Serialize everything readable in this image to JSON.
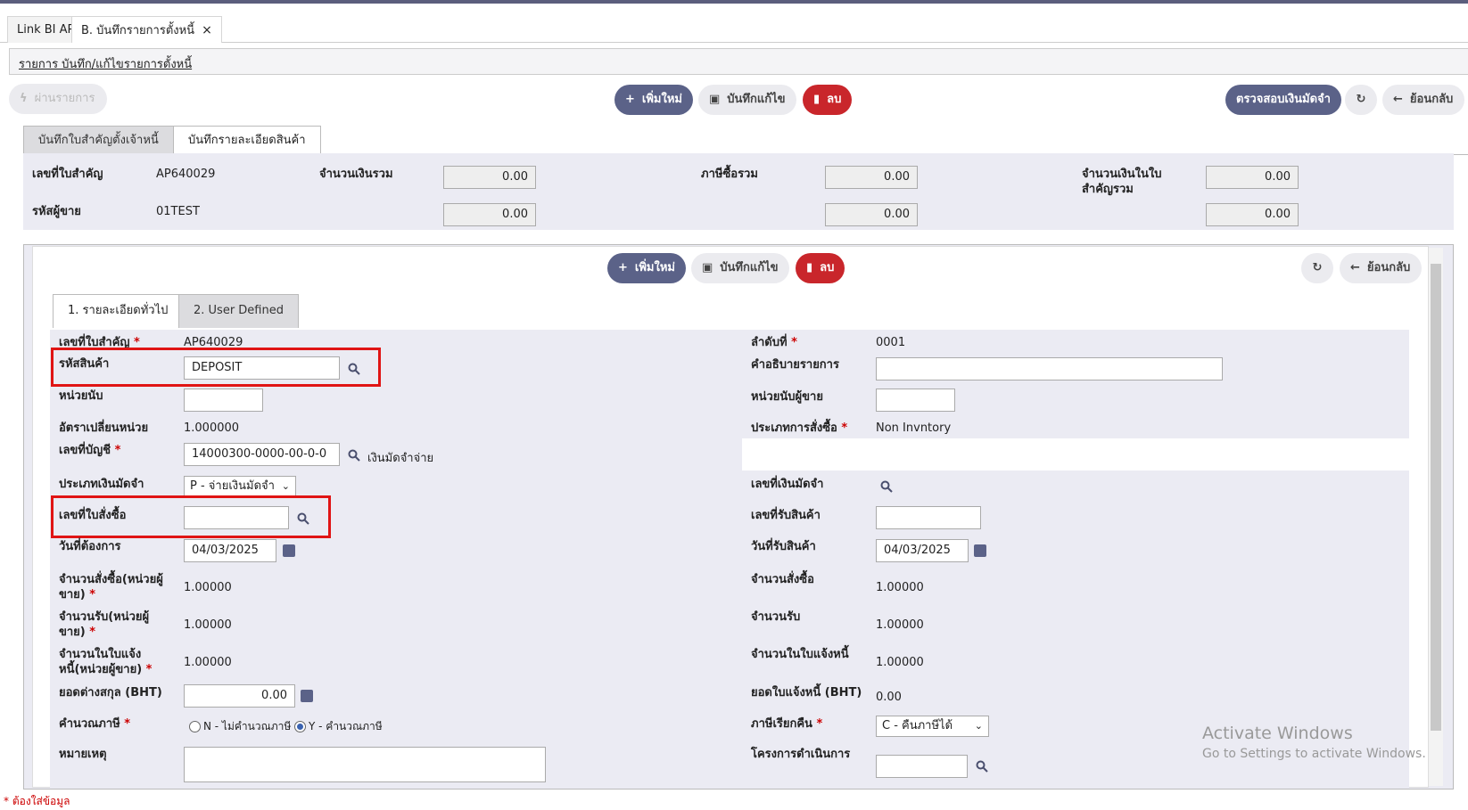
{
  "tabs": [
    {
      "label": "Link BI AP"
    },
    {
      "label": "B. บันทึกรายการตั้งหนี้",
      "close": "×"
    }
  ],
  "breadcrumb": "รายการ บันทึก/แก้ไขรายการตั้งหนี้",
  "toolbar": {
    "pass_label": "ผ่านรายการ",
    "add_label": "เพิ่มใหม่",
    "save_label": "บันทึกแก้ไข",
    "delete_label": "ลบ",
    "check_deposit_label": "ตรวจสอบเงินมัดจำ",
    "back_label": "ย้อนกลับ"
  },
  "subtabs": [
    "บันทึกใบสำคัญตั้งเจ้าหนี้",
    "บันทึกรายละเอียดสินค้า"
  ],
  "header": {
    "voucher_no_label": "เลขที่ใบสำคัญ",
    "voucher_no": "AP640029",
    "vendor_code_label": "รหัสผู้ขาย",
    "vendor_code": "01TEST",
    "total_amount_label": "จำนวนเงินรวม",
    "total_tax_label": "ภาษีซื้อรวม",
    "voucher_total_label": "จำนวนเงินในใบสำคัญรวม",
    "amounts": [
      "0.00",
      "0.00",
      "0.00",
      "0.00",
      "0.00",
      "0.00"
    ]
  },
  "inner_toolbar": {
    "add_label": "เพิ่มใหม่",
    "save_label": "บันทึกแก้ไข",
    "delete_label": "ลบ",
    "back_label": "ย้อนกลับ"
  },
  "inner_tabs": [
    "1. รายละเอียดทั่วไป",
    "2. User Defined"
  ],
  "form": {
    "voucher_no_label": "เลขที่ใบสำคัญ",
    "voucher_no": "AP640029",
    "seq_label": "ลำดับที่",
    "seq": "0001",
    "product_code_label": "รหัสสินค้า",
    "product_code": "DEPOSIT",
    "desc_label": "คำอธิบายรายการ",
    "unit_label": "หน่วยนับ",
    "vendor_unit_label": "หน่วยนับผู้ขาย",
    "conv_rate_label": "อัตราเปลี่ยนหน่วย",
    "conv_rate": "1.000000",
    "order_type_label": "ประเภทการสั่งซื้อ",
    "order_type": "Non Invntory",
    "account_label": "เลขที่บัญชี",
    "account": "14000300-0000-00-0-0",
    "account_name": "เงินมัดจำจ่าย",
    "deposit_type_label": "ประเภทเงินมัดจำ",
    "deposit_type": "P - จ่ายเงินมัดจำ",
    "deposit_no_label": "เลขที่เงินมัดจำ",
    "po_no_label": "เลขที่ใบสั่งซื้อ",
    "receipt_no_label": "เลขที่รับสินค้า",
    "req_date_label": "วันที่ต้องการ",
    "req_date": "04/03/2025",
    "receipt_date_label": "วันที่รับสินค้า",
    "receipt_date": "04/03/2025",
    "order_qty_vendor_label": "จำนวนสั่งซื้อ(หน่วยผู้ขาย)",
    "order_qty_vendor": "1.00000",
    "order_qty_label": "จำนวนสั่งซื้อ",
    "order_qty": "1.00000",
    "recv_qty_vendor_label": "จำนวนรับ(หน่วยผู้ขาย)",
    "recv_qty_vendor": "1.00000",
    "recv_qty_label": "จำนวนรับ",
    "recv_qty": "1.00000",
    "inv_qty_vendor_label": "จำนวนในใบแจ้งหนี้(หน่วยผู้ขาย)",
    "inv_qty_vendor": "1.00000",
    "inv_qty_label": "จำนวนในใบแจ้งหนี้",
    "inv_qty": "1.00000",
    "fx_amount_label": "ยอดต่างสกุล (BHT)",
    "fx_amount": "0.00",
    "inv_amount_label": "ยอดใบแจ้งหนี้ (BHT)",
    "inv_amount": "0.00",
    "calc_tax_label": "คำนวณภาษี",
    "calc_tax_n": "N - ไม่คำนวณภาษี",
    "calc_tax_y": "Y - คำนวณภาษี",
    "tax_refund_label": "ภาษีเรียกคืน",
    "tax_refund": "C - คืนภาษีได้",
    "remark_label": "หมายเหตุ",
    "project_label": "โครงการดำเนินการ"
  },
  "watermark": {
    "line1": "Activate Windows",
    "line2": "Go to Settings to activate Windows."
  },
  "footer_note": "* ต้องใส่ข้อมูล",
  "colors": {
    "primary": "#5b6288",
    "danger": "#c9262b",
    "highlight": "#e01414",
    "panel": "#ebebf3"
  }
}
